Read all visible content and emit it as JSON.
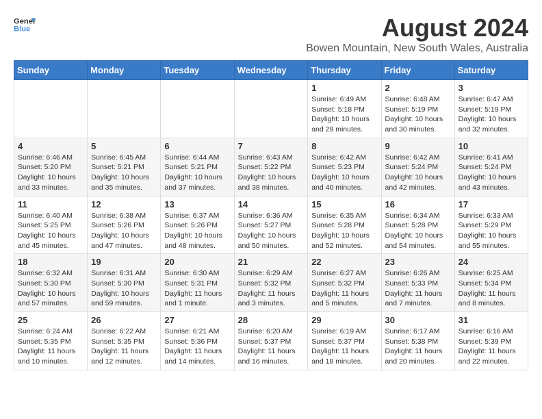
{
  "logo": {
    "line1": "General",
    "line2": "Blue"
  },
  "title": "August 2024",
  "subtitle": "Bowen Mountain, New South Wales, Australia",
  "days_of_week": [
    "Sunday",
    "Monday",
    "Tuesday",
    "Wednesday",
    "Thursday",
    "Friday",
    "Saturday"
  ],
  "weeks": [
    [
      {
        "day": "",
        "info": ""
      },
      {
        "day": "",
        "info": ""
      },
      {
        "day": "",
        "info": ""
      },
      {
        "day": "",
        "info": ""
      },
      {
        "day": "1",
        "info": "Sunrise: 6:49 AM\nSunset: 5:18 PM\nDaylight: 10 hours\nand 29 minutes."
      },
      {
        "day": "2",
        "info": "Sunrise: 6:48 AM\nSunset: 5:19 PM\nDaylight: 10 hours\nand 30 minutes."
      },
      {
        "day": "3",
        "info": "Sunrise: 6:47 AM\nSunset: 5:19 PM\nDaylight: 10 hours\nand 32 minutes."
      }
    ],
    [
      {
        "day": "4",
        "info": "Sunrise: 6:46 AM\nSunset: 5:20 PM\nDaylight: 10 hours\nand 33 minutes."
      },
      {
        "day": "5",
        "info": "Sunrise: 6:45 AM\nSunset: 5:21 PM\nDaylight: 10 hours\nand 35 minutes."
      },
      {
        "day": "6",
        "info": "Sunrise: 6:44 AM\nSunset: 5:21 PM\nDaylight: 10 hours\nand 37 minutes."
      },
      {
        "day": "7",
        "info": "Sunrise: 6:43 AM\nSunset: 5:22 PM\nDaylight: 10 hours\nand 38 minutes."
      },
      {
        "day": "8",
        "info": "Sunrise: 6:42 AM\nSunset: 5:23 PM\nDaylight: 10 hours\nand 40 minutes."
      },
      {
        "day": "9",
        "info": "Sunrise: 6:42 AM\nSunset: 5:24 PM\nDaylight: 10 hours\nand 42 minutes."
      },
      {
        "day": "10",
        "info": "Sunrise: 6:41 AM\nSunset: 5:24 PM\nDaylight: 10 hours\nand 43 minutes."
      }
    ],
    [
      {
        "day": "11",
        "info": "Sunrise: 6:40 AM\nSunset: 5:25 PM\nDaylight: 10 hours\nand 45 minutes."
      },
      {
        "day": "12",
        "info": "Sunrise: 6:38 AM\nSunset: 5:26 PM\nDaylight: 10 hours\nand 47 minutes."
      },
      {
        "day": "13",
        "info": "Sunrise: 6:37 AM\nSunset: 5:26 PM\nDaylight: 10 hours\nand 48 minutes."
      },
      {
        "day": "14",
        "info": "Sunrise: 6:36 AM\nSunset: 5:27 PM\nDaylight: 10 hours\nand 50 minutes."
      },
      {
        "day": "15",
        "info": "Sunrise: 6:35 AM\nSunset: 5:28 PM\nDaylight: 10 hours\nand 52 minutes."
      },
      {
        "day": "16",
        "info": "Sunrise: 6:34 AM\nSunset: 5:28 PM\nDaylight: 10 hours\nand 54 minutes."
      },
      {
        "day": "17",
        "info": "Sunrise: 6:33 AM\nSunset: 5:29 PM\nDaylight: 10 hours\nand 55 minutes."
      }
    ],
    [
      {
        "day": "18",
        "info": "Sunrise: 6:32 AM\nSunset: 5:30 PM\nDaylight: 10 hours\nand 57 minutes."
      },
      {
        "day": "19",
        "info": "Sunrise: 6:31 AM\nSunset: 5:30 PM\nDaylight: 10 hours\nand 59 minutes."
      },
      {
        "day": "20",
        "info": "Sunrise: 6:30 AM\nSunset: 5:31 PM\nDaylight: 11 hours\nand 1 minute."
      },
      {
        "day": "21",
        "info": "Sunrise: 6:29 AM\nSunset: 5:32 PM\nDaylight: 11 hours\nand 3 minutes."
      },
      {
        "day": "22",
        "info": "Sunrise: 6:27 AM\nSunset: 5:32 PM\nDaylight: 11 hours\nand 5 minutes."
      },
      {
        "day": "23",
        "info": "Sunrise: 6:26 AM\nSunset: 5:33 PM\nDaylight: 11 hours\nand 7 minutes."
      },
      {
        "day": "24",
        "info": "Sunrise: 6:25 AM\nSunset: 5:34 PM\nDaylight: 11 hours\nand 8 minutes."
      }
    ],
    [
      {
        "day": "25",
        "info": "Sunrise: 6:24 AM\nSunset: 5:35 PM\nDaylight: 11 hours\nand 10 minutes."
      },
      {
        "day": "26",
        "info": "Sunrise: 6:22 AM\nSunset: 5:35 PM\nDaylight: 11 hours\nand 12 minutes."
      },
      {
        "day": "27",
        "info": "Sunrise: 6:21 AM\nSunset: 5:36 PM\nDaylight: 11 hours\nand 14 minutes."
      },
      {
        "day": "28",
        "info": "Sunrise: 6:20 AM\nSunset: 5:37 PM\nDaylight: 11 hours\nand 16 minutes."
      },
      {
        "day": "29",
        "info": "Sunrise: 6:19 AM\nSunset: 5:37 PM\nDaylight: 11 hours\nand 18 minutes."
      },
      {
        "day": "30",
        "info": "Sunrise: 6:17 AM\nSunset: 5:38 PM\nDaylight: 11 hours\nand 20 minutes."
      },
      {
        "day": "31",
        "info": "Sunrise: 6:16 AM\nSunset: 5:39 PM\nDaylight: 11 hours\nand 22 minutes."
      }
    ]
  ]
}
